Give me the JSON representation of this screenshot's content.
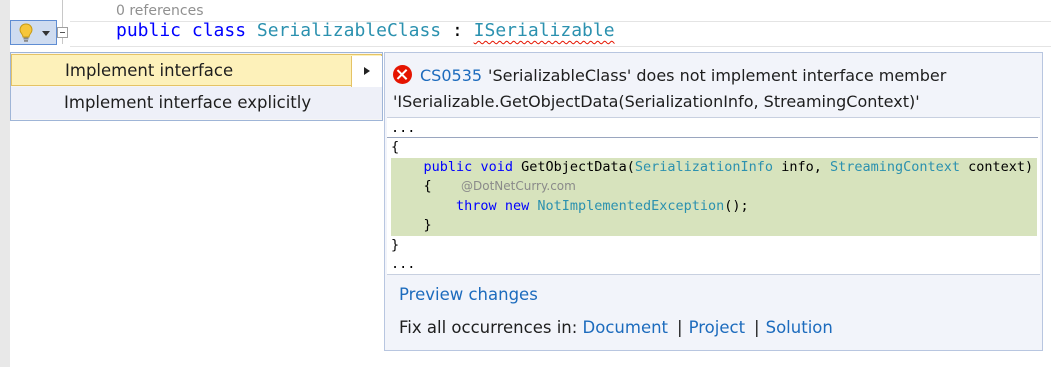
{
  "editor": {
    "codelens": "0 references",
    "code": {
      "kw_public": "public",
      "kw_class": "class",
      "class_name": "SerializableClass",
      "colon": ":",
      "interface_name": "ISerializable"
    }
  },
  "lightbulb": {
    "icon": "lightbulb-icon",
    "caret_icon": "chevron-down-icon"
  },
  "menu": {
    "items": [
      {
        "label": "Implement interface"
      },
      {
        "label": "Implement interface explicitly"
      }
    ]
  },
  "preview": {
    "error_code": "CS0535",
    "error_message": "'SerializableClass' does not implement interface member 'ISerializable.GetObjectData(SerializationInfo, StreamingContext)'",
    "code": {
      "ellipsis_top": "...",
      "brace_open": "{",
      "method_kw_public": "public",
      "method_kw_void": "void",
      "method_name": "GetObjectData(",
      "param1_type": "SerializationInfo",
      "param1_name": " info, ",
      "param2_type": "StreamingContext",
      "param2_name": " context)",
      "inner_open": "{",
      "throw_kw": "throw",
      "new_kw": "new",
      "exception_type": "NotImplementedException",
      "exception_tail": "();",
      "inner_close": "}",
      "brace_close": "}",
      "ellipsis_bottom": "..."
    },
    "watermark": "@DotNetCurry.com",
    "preview_changes": "Preview changes",
    "fix_all_label": "Fix all occurrences in:",
    "fix_document": "Document",
    "fix_project": "Project",
    "fix_solution": "Solution",
    "separator": "|"
  },
  "colors": {
    "keyword": "#0000ff",
    "type": "#2b91af",
    "link": "#1c6bbd",
    "error": "#e51400",
    "highlight": "#d7e3bd",
    "menu_hot": "#fdf1ba"
  }
}
